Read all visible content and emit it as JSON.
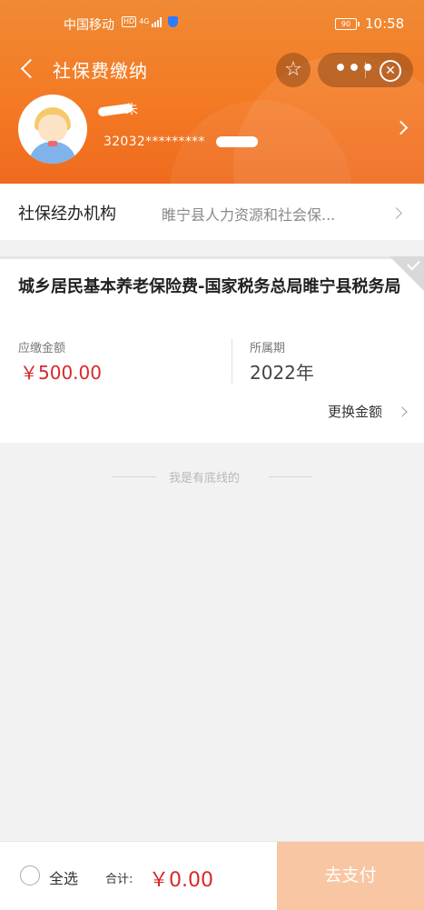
{
  "status_bar": {
    "carrier": "中国移动",
    "hd": "HD",
    "network": "4G",
    "battery": "90",
    "time": "10:58"
  },
  "nav": {
    "title": "社保费缴纳",
    "star_icon": "star-icon",
    "more_icon": "more-dots-icon",
    "close_icon": "close-circle-icon"
  },
  "profile": {
    "name_visible": "朱",
    "id_number": "32032*********"
  },
  "agency": {
    "label": "社保经办机构",
    "value": "睢宁县人力资源和社会保..."
  },
  "card": {
    "title": "城乡居民基本养老保险费-国家税务总局睢宁县税务局",
    "amount_label": "应缴金额",
    "amount": "￥500.00",
    "period_label": "所属期",
    "period": "2022年",
    "change_amount": "更换金额",
    "selected": true
  },
  "bottom_line_text": "我是有底线的",
  "footer": {
    "select_all": "全选",
    "total_label": "合计:",
    "total_value": "￥0.00",
    "pay_button": "去支付"
  },
  "colors": {
    "header_orange": "#f47a24",
    "price_red": "#d8282a",
    "pay_button_disabled": "#f8c6a2"
  }
}
